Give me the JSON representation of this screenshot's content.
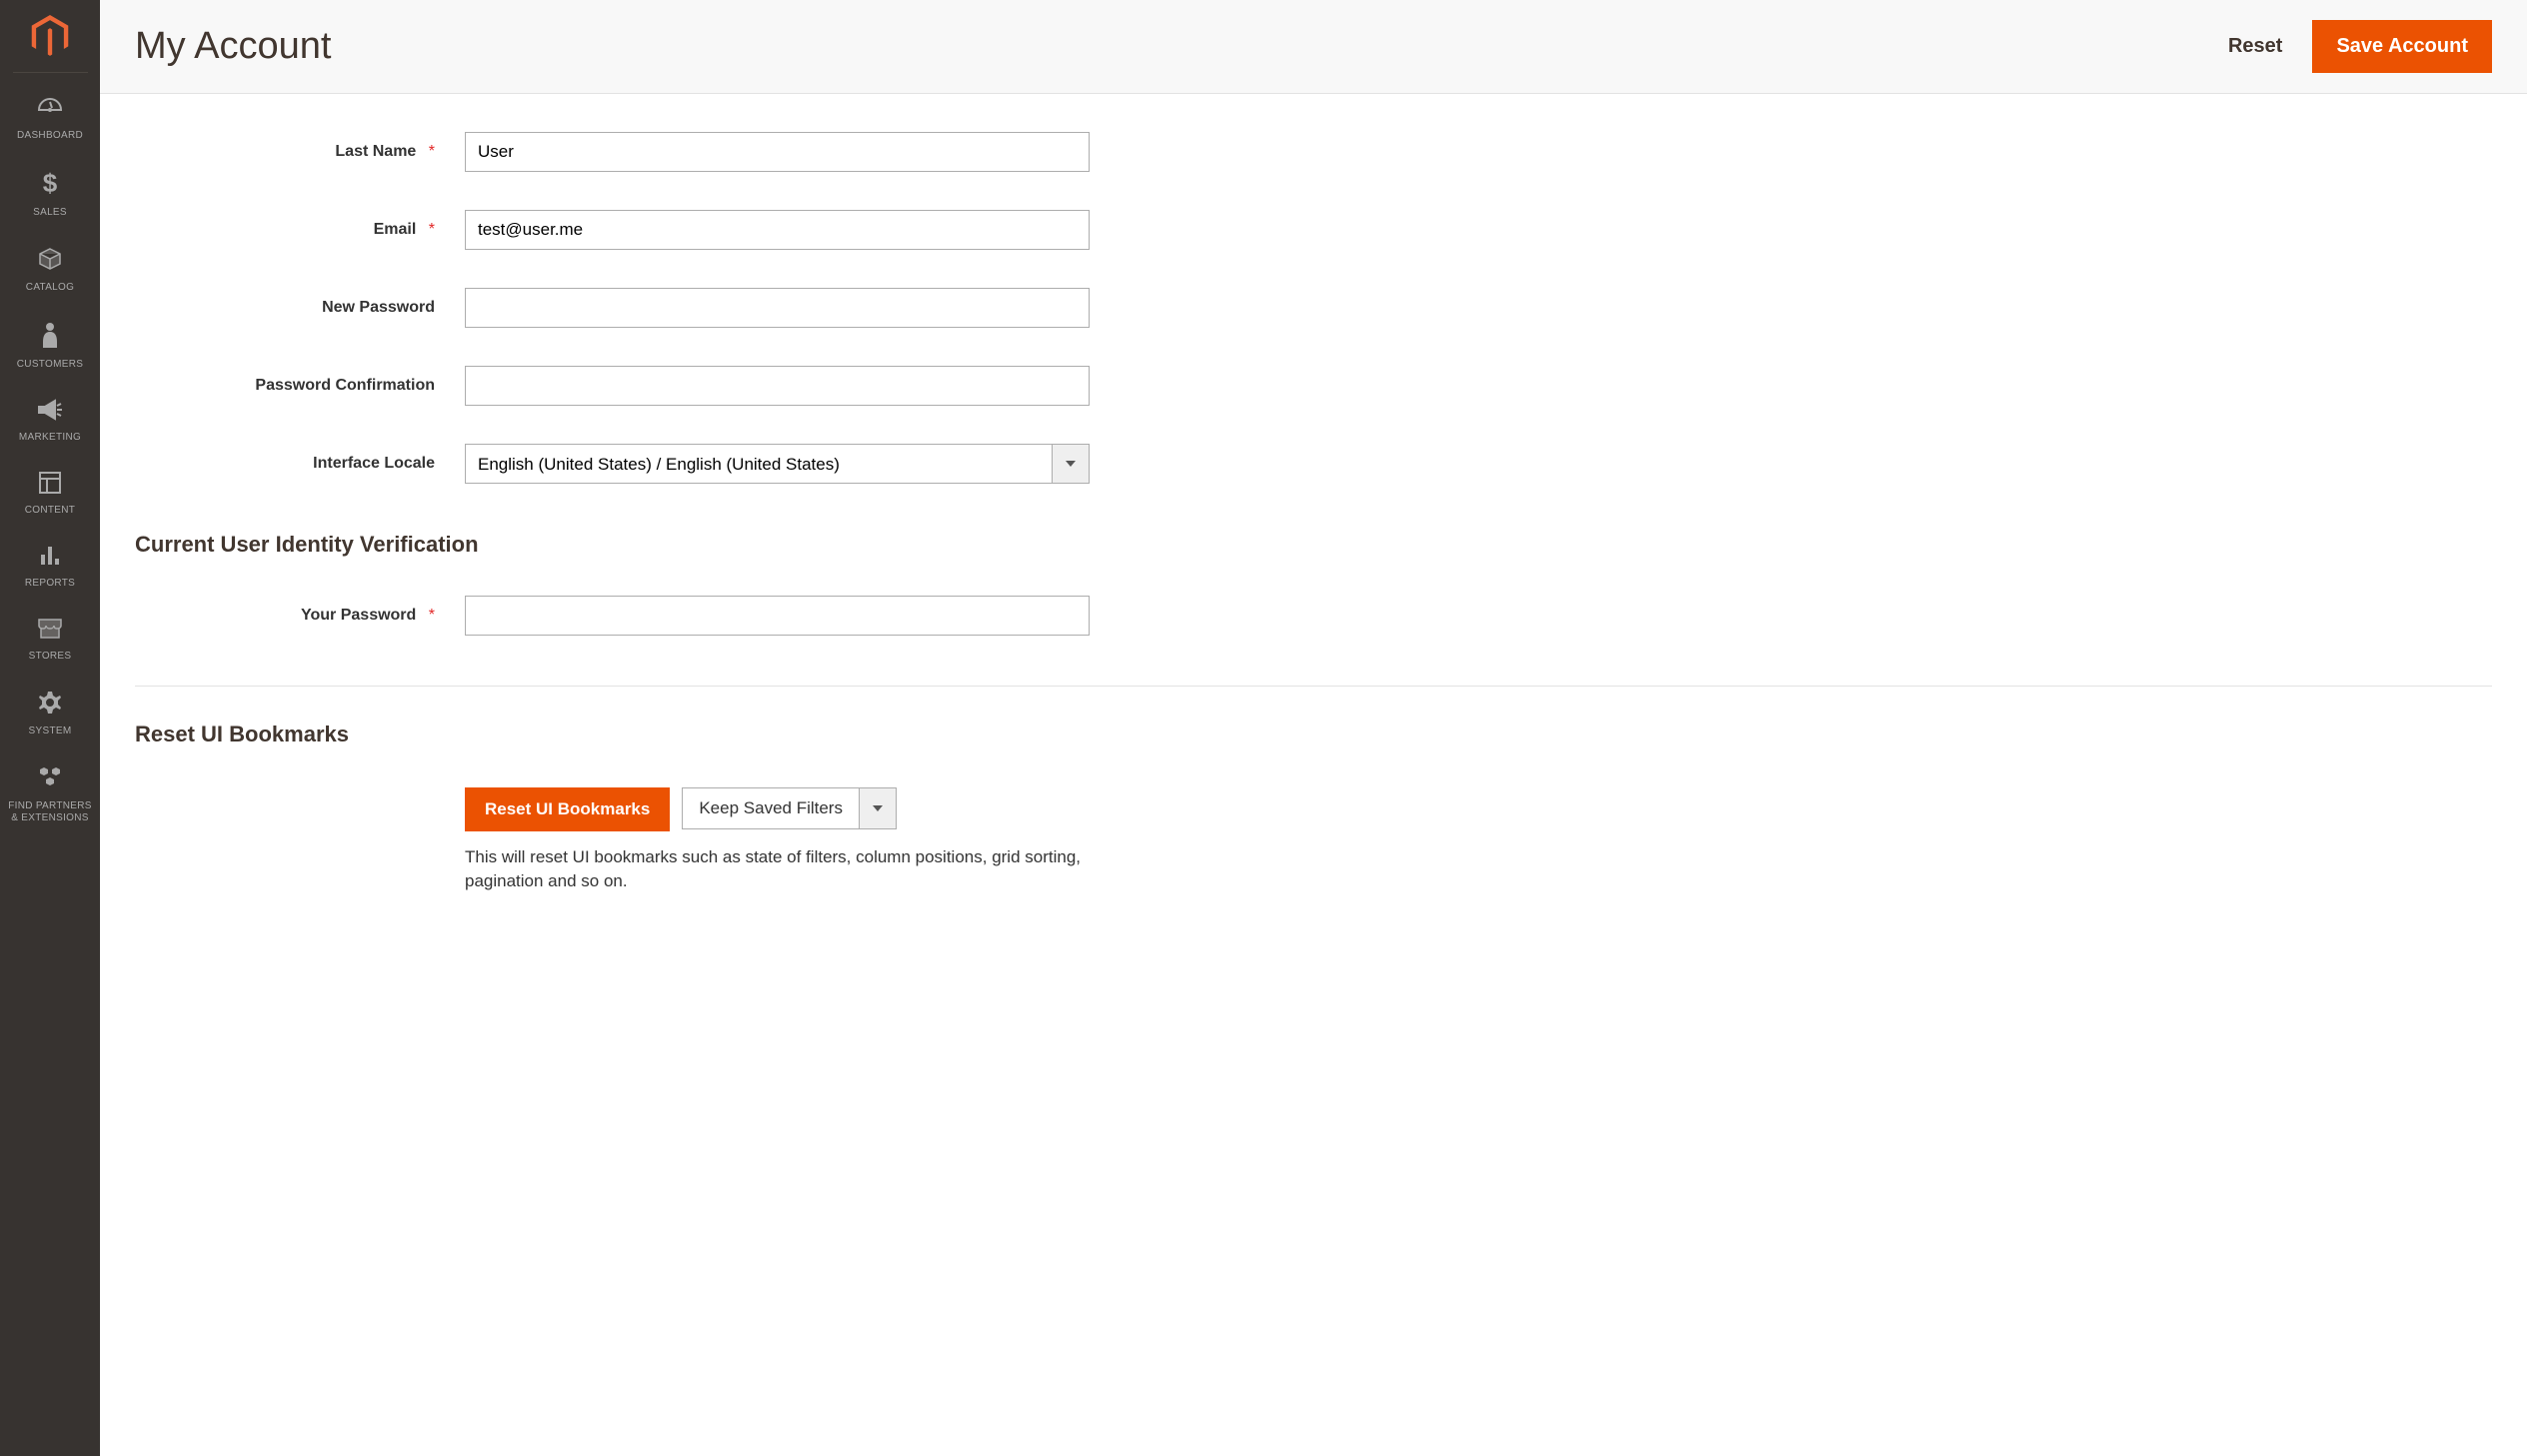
{
  "sidebar": {
    "items": [
      {
        "label": "DASHBOARD",
        "icon": "dashboard"
      },
      {
        "label": "SALES",
        "icon": "dollar"
      },
      {
        "label": "CATALOG",
        "icon": "cube"
      },
      {
        "label": "CUSTOMERS",
        "icon": "person"
      },
      {
        "label": "MARKETING",
        "icon": "megaphone"
      },
      {
        "label": "CONTENT",
        "icon": "layout"
      },
      {
        "label": "REPORTS",
        "icon": "bars"
      },
      {
        "label": "STORES",
        "icon": "storefront"
      },
      {
        "label": "SYSTEM",
        "icon": "gear"
      },
      {
        "label": "FIND PARTNERS & EXTENSIONS",
        "icon": "blocks"
      }
    ]
  },
  "header": {
    "title": "My Account",
    "reset_label": "Reset",
    "save_label": "Save Account"
  },
  "form": {
    "last_name": {
      "label": "Last Name",
      "value": "User",
      "required": true
    },
    "email": {
      "label": "Email",
      "value": "test@user.me",
      "required": true
    },
    "new_password": {
      "label": "New Password",
      "value": "",
      "required": false
    },
    "password_confirmation": {
      "label": "Password Confirmation",
      "value": "",
      "required": false
    },
    "interface_locale": {
      "label": "Interface Locale",
      "value": "English (United States) / English (United States)",
      "required": false
    },
    "verification_heading": "Current User Identity Verification",
    "your_password": {
      "label": "Your Password",
      "value": "",
      "required": true
    }
  },
  "bookmarks": {
    "heading": "Reset UI Bookmarks",
    "reset_button": "Reset UI Bookmarks",
    "filter_option": "Keep Saved Filters",
    "help_text": "This will reset UI bookmarks such as state of filters, column positions, grid sorting, pagination and so on."
  }
}
